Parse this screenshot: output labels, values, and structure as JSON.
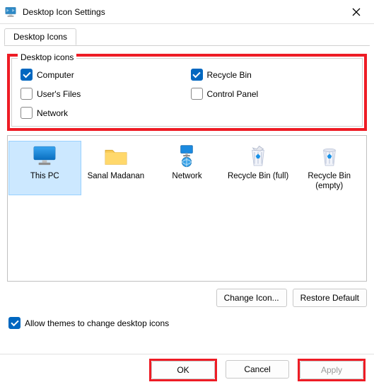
{
  "window": {
    "title": "Desktop Icon Settings"
  },
  "tab": {
    "label": "Desktop Icons"
  },
  "fieldset": {
    "legend": "Desktop icons",
    "checks": {
      "computer": "Computer",
      "users_files": "User's Files",
      "network": "Network",
      "recycle_bin": "Recycle Bin",
      "control_panel": "Control Panel"
    }
  },
  "preview": {
    "items": {
      "this_pc": "This PC",
      "user_folder": "Sanal Madanan",
      "network": "Network",
      "recycle_full": "Recycle Bin (full)",
      "recycle_empty": "Recycle Bin (empty)"
    }
  },
  "buttons": {
    "change_icon": "Change Icon...",
    "restore_default": "Restore Default",
    "ok": "OK",
    "cancel": "Cancel",
    "apply": "Apply"
  },
  "allow_themes": "Allow themes to change desktop icons"
}
